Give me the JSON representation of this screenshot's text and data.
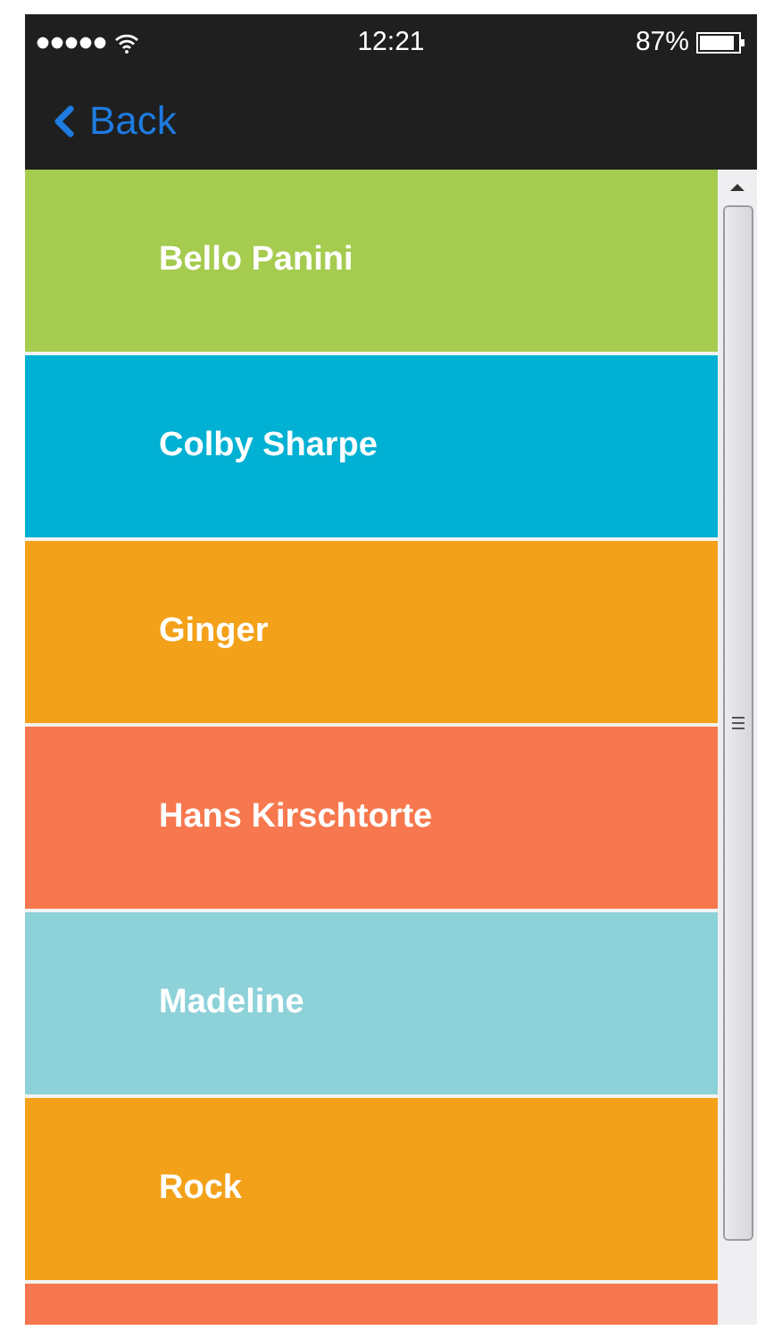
{
  "status_bar": {
    "time": "12:21",
    "battery_text": "87%"
  },
  "nav_bar": {
    "back_label": "Back"
  },
  "rows": [
    {
      "name": "Bello Panini",
      "color": "#a5cb4f"
    },
    {
      "name": "Colby Sharpe",
      "color": "#00b1d3"
    },
    {
      "name": "Ginger",
      "color": "#f4a11a"
    },
    {
      "name": "Hans Kirschtorte",
      "color": "#f7784e"
    },
    {
      "name": "Madeline",
      "color": "#8dd1d9"
    },
    {
      "name": "Rock",
      "color": "#f4a11a"
    },
    {
      "color": "#f7784e"
    }
  ]
}
